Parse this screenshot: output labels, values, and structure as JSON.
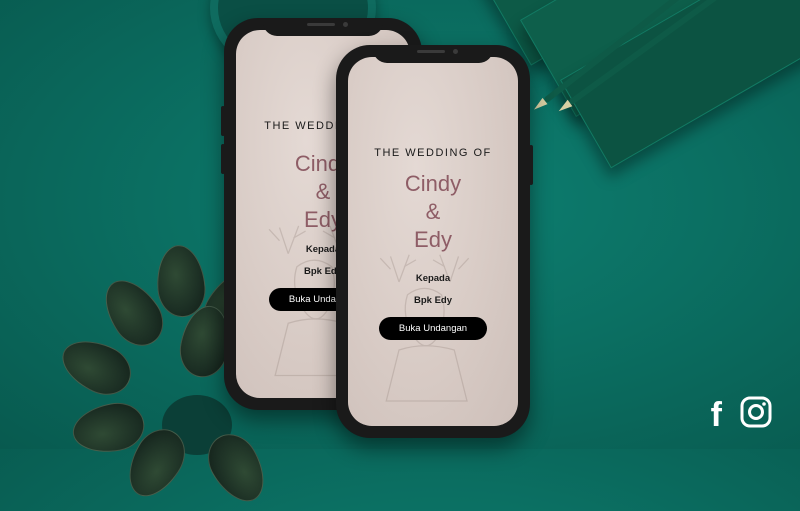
{
  "invitation": {
    "heading": "THE WEDDING OF",
    "name_one": "Cindy",
    "ampersand": "&",
    "name_two": "Edy",
    "to_label": "Kepada",
    "guest_name": "Bpk Edy",
    "open_button": "Buka Undangan"
  },
  "social": {
    "facebook_icon": "facebook-icon",
    "facebook_glyph": "f",
    "instagram_icon": "instagram-icon"
  },
  "colors": {
    "background": "#0b6f62",
    "name_accent": "#8e5d66",
    "button": "#000000",
    "screen": "#ddd1cb"
  }
}
